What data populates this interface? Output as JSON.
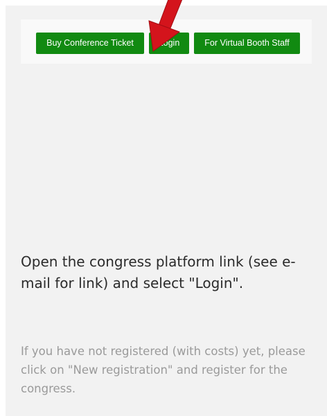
{
  "buttons": {
    "buy_ticket": "Buy Conference Ticket",
    "login": "Login",
    "virtual_booth_staff": "For Virtual Booth Staff"
  },
  "instruction": "Open the congress platform link (see e-mail for link) and select \"Login\".",
  "note": "If you have not registered (with costs) yet, please click on \"New registration\" and register for the congress.",
  "colors": {
    "button_green": "#118a11",
    "arrow_red": "#d4141c",
    "panel_bg": "#f2f2f2"
  },
  "icons": {
    "pointer": "red-arrow-icon"
  }
}
